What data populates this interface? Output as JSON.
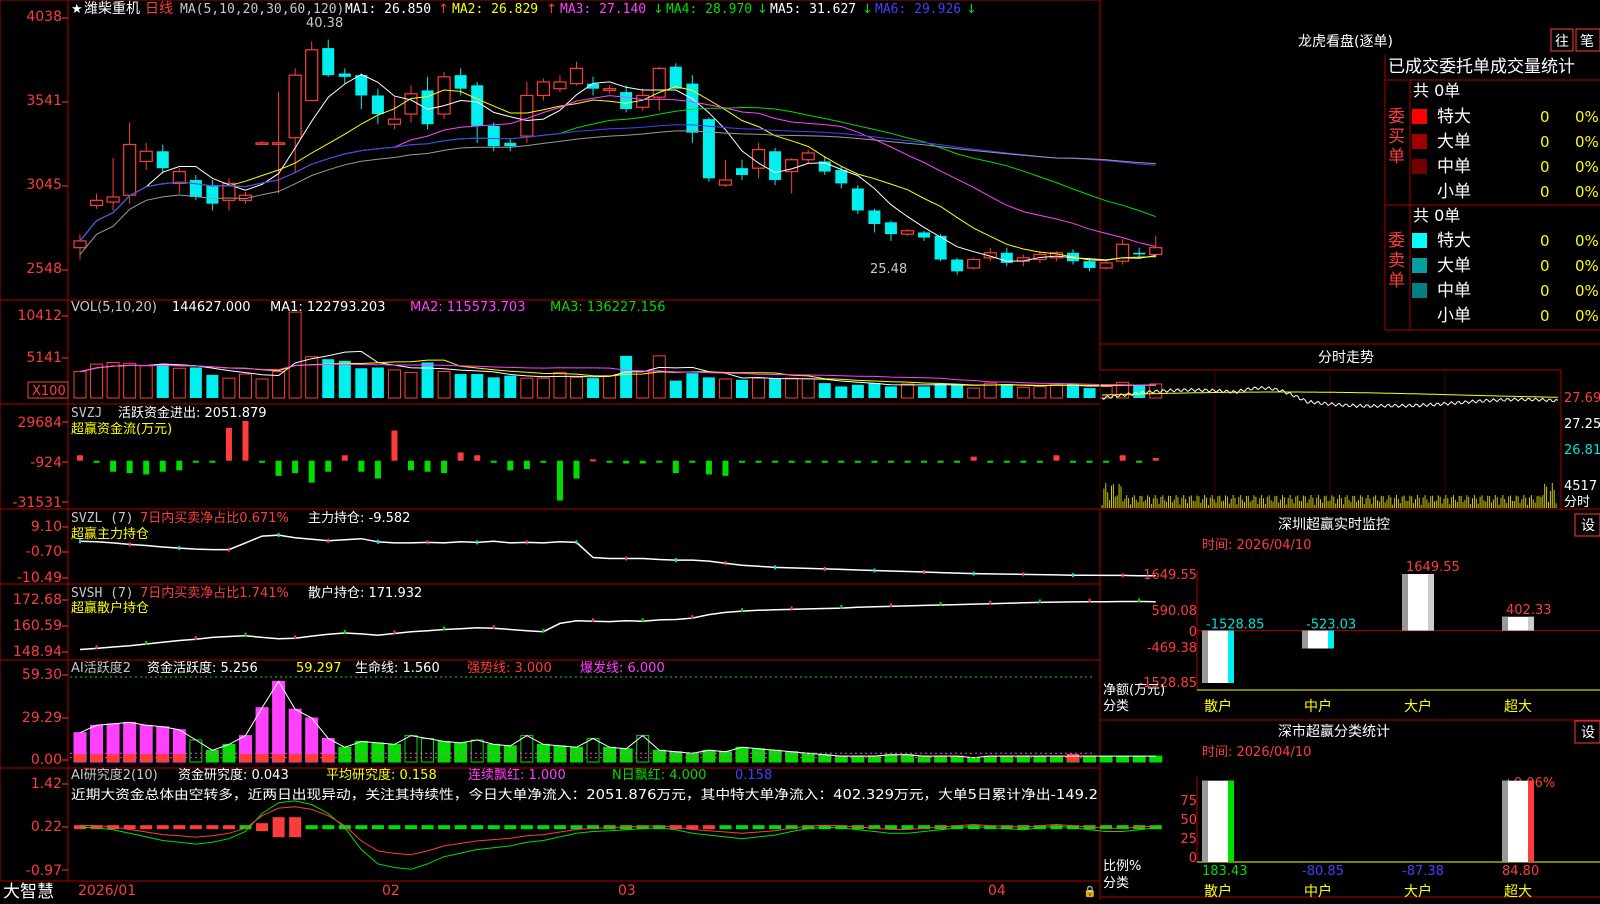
{
  "colors": {
    "grid_red": "#b00000",
    "axis_red": "#ff3c3c",
    "up": "#ff3c3c",
    "down": "#00f0f0",
    "white": "#ffffff",
    "yellow": "#ffff00",
    "magenta": "#ff40ff",
    "green": "#00dd00",
    "blue": "#4040ff",
    "gray": "#9a9a9a",
    "cyan_text": "#00e0e0"
  },
  "header": {
    "star": "★",
    "stock_name": "潍柴重机",
    "period": "日线",
    "ma_prefix": "MA(5,10,20,30,60,120)",
    "ma1": "MA1: 26.850",
    "ma1_arrow": "↑",
    "ma2": "MA2: 26.829",
    "ma2_arrow": "↑",
    "ma3": "MA3: 27.140",
    "ma3_arrow": "↓",
    "ma4": "MA4: 28.970",
    "ma4_arrow": "↓",
    "ma5": "MA5: 31.627",
    "ma5_arrow": "↓",
    "ma6": "MA6: 29.926",
    "ma6_arrow": "↓"
  },
  "kline": {
    "y_ticks": [
      "4038",
      "3541",
      "3045",
      "2548"
    ],
    "annot_high": "40.38",
    "annot_low": "25.48"
  },
  "vol": {
    "title": "VOL(5,10,20)",
    "value": "144627.000",
    "ma1": "MA1: 122793.203",
    "ma2": "MA2: 115573.703",
    "ma3": "MA3: 136227.156",
    "y_ticks": [
      "10412",
      "5141"
    ],
    "unit": "X100"
  },
  "svzj": {
    "title": "SVZJ",
    "label": "活跃资金进出: 2051.879",
    "sub": "超赢资金流(万元)",
    "y_ticks": [
      "29684",
      "-924",
      "-31531"
    ]
  },
  "svzl": {
    "title": "SVZL (7)",
    "label1": "7日内买卖净占比0.671%",
    "label2": "主力持仓: -9.582",
    "sub": "超赢主力持仓",
    "y_ticks": [
      "9.10",
      "-0.70",
      "-10.49"
    ]
  },
  "svsh": {
    "title": "SVSH (7)",
    "label1": "7日内买卖净占比1.741%",
    "label2": "散户持仓: 171.932",
    "sub": "超赢散户持仓",
    "y_ticks": [
      "172.68",
      "160.59",
      "148.94"
    ]
  },
  "ai1": {
    "title": "AI活跃度2",
    "label1": "资金活跃度: 5.256",
    "label2": "59.297",
    "label3": "生命线: 1.560",
    "label4": "强势线: 3.000",
    "label5": "爆发线: 6.000",
    "y_ticks": [
      "59.30",
      "29.29",
      "0.00"
    ]
  },
  "ai2": {
    "title": "AI研究度2(10)",
    "label1": "资金研究度: 0.043",
    "label2": "平均研究度: 0.158",
    "label3": "连续飘红: 1.000",
    "label4": "N日飘红: 4.000",
    "label5": "0.158",
    "commentary": "近期大资金总体由空转多，近两日出现异动，关注其持续性，今日大单净流入：2051.876万元，其中特大单净流入：402.329万元，大单5日累计净出-149.2",
    "y_ticks": [
      "1.42",
      "0.22",
      "-0.97"
    ]
  },
  "xaxis": {
    "brand": "大智慧",
    "labels": [
      "2026/01",
      "02",
      "03",
      "04"
    ]
  },
  "dragon_tiger": {
    "title": "龙虎看盘(逐单)",
    "btn1": "往",
    "btn2": "笔",
    "headline": "已成交委托单成交量统计",
    "buy_group": "委买单",
    "sell_group": "委卖单",
    "buy_total": "共 0单",
    "sell_total": "共 0单",
    "buy_rows": [
      {
        "label": "特大",
        "count": "0",
        "pct": "0%",
        "color": "#ff0000"
      },
      {
        "label": "大单",
        "count": "0",
        "pct": "0%",
        "color": "#a00000"
      },
      {
        "label": "中单",
        "count": "0",
        "pct": "0%",
        "color": "#700000"
      },
      {
        "label": "小单",
        "count": "0",
        "pct": "0%",
        "color": ""
      }
    ],
    "sell_rows": [
      {
        "label": "特大",
        "count": "0",
        "pct": "0%",
        "color": "#00ffff"
      },
      {
        "label": "大单",
        "count": "0",
        "pct": "0%",
        "color": "#00a0a0"
      },
      {
        "label": "中单",
        "count": "0",
        "pct": "0%",
        "color": "#008080"
      },
      {
        "label": "小单",
        "count": "0",
        "pct": "0%",
        "color": ""
      }
    ]
  },
  "intraday": {
    "title": "分时走势",
    "y_ticks": [
      "27.69",
      "27.25",
      "26.81"
    ],
    "vol_tick": "4517",
    "vol_unit": "分时"
  },
  "monitor": {
    "title": "深圳超赢实时监控",
    "btn": "设",
    "date": "时间: 2026/04/10",
    "y_ticks": [
      "1649.55",
      "590.08",
      "0",
      "-469.38",
      "-1528.85"
    ],
    "axis_title": "净额(万元)",
    "axis_sub": "分类",
    "categories": [
      "散户",
      "中户",
      "大户",
      "超大"
    ],
    "values": [
      -1528.85,
      -523.03,
      1649.55,
      402.33
    ],
    "value_labels": [
      "-1528.85",
      "-523.03",
      "1649.55",
      "402.33"
    ]
  },
  "classify": {
    "title": "深市超赢分类统计",
    "btn": "设",
    "date": "时间: 2026/04/10",
    "y_ticks": [
      "75",
      "50",
      "25",
      "0"
    ],
    "axis_title": "比例%",
    "axis_sub": "分类",
    "categories": [
      "散户",
      "中户",
      "大户",
      "超大"
    ],
    "values": [
      183.43,
      -80.85,
      -87.38,
      84.8
    ],
    "value_labels": [
      "183.43",
      "-80.85",
      "-87.38",
      "84.80"
    ],
    "annot": "+0.06%"
  },
  "chart_data": [
    {
      "type": "candlestick",
      "title": "潍柴重机 日线",
      "x_labels": [
        "2026/01",
        "02",
        "03",
        "04"
      ],
      "ylim": [
        2548,
        4038
      ],
      "candles": [
        [
          2680,
          2720,
          2610,
          2760
        ],
        [
          2930,
          2960,
          2910,
          3000
        ],
        [
          2950,
          2980,
          2900,
          3210
        ],
        [
          2990,
          3290,
          2940,
          3420
        ],
        [
          3190,
          3250,
          3140,
          3300
        ],
        [
          3250,
          3150,
          3120,
          3290
        ],
        [
          3060,
          3130,
          3000,
          3150
        ],
        [
          3080,
          2980,
          2960,
          3110
        ],
        [
          3050,
          2940,
          2900,
          3080
        ],
        [
          2960,
          3060,
          2900,
          3090
        ],
        [
          2960,
          2990,
          2940,
          3010
        ],
        [
          3300,
          3300,
          3300,
          3310
        ],
        [
          3300,
          3300,
          3000,
          3600
        ],
        [
          3330,
          3700,
          3120,
          3740
        ],
        [
          3550,
          3850,
          3600,
          3900
        ],
        [
          3860,
          3700,
          3690,
          3910
        ],
        [
          3710,
          3690,
          3650,
          3740
        ],
        [
          3700,
          3580,
          3500,
          3710
        ],
        [
          3580,
          3470,
          3410,
          3620
        ],
        [
          3410,
          3440,
          3380,
          3570
        ],
        [
          3470,
          3590,
          3420,
          3640
        ],
        [
          3610,
          3410,
          3380,
          3690
        ],
        [
          3470,
          3690,
          3440,
          3720
        ],
        [
          3700,
          3620,
          3580,
          3740
        ],
        [
          3640,
          3400,
          3300,
          3660
        ],
        [
          3400,
          3280,
          3250,
          3420
        ],
        [
          3300,
          3280,
          3250,
          3320
        ],
        [
          3340,
          3580,
          3300,
          3660
        ],
        [
          3580,
          3660,
          3550,
          3680
        ],
        [
          3620,
          3660,
          3600,
          3700
        ],
        [
          3650,
          3740,
          3640,
          3780
        ],
        [
          3650,
          3620,
          3580,
          3690
        ],
        [
          3610,
          3620,
          3590,
          3640
        ],
        [
          3600,
          3500,
          3480,
          3640
        ],
        [
          3510,
          3580,
          3490,
          3620
        ],
        [
          3570,
          3740,
          3490,
          3750
        ],
        [
          3750,
          3620,
          3640,
          3770
        ],
        [
          3650,
          3360,
          3300,
          3700
        ],
        [
          3440,
          3090,
          3070,
          3450
        ],
        [
          3050,
          3080,
          3040,
          3200
        ],
        [
          3150,
          3110,
          3080,
          3200
        ],
        [
          3150,
          3260,
          3090,
          3300
        ],
        [
          3250,
          3080,
          3050,
          3270
        ],
        [
          3130,
          3200,
          3000,
          3210
        ],
        [
          3200,
          3240,
          3180,
          3260
        ],
        [
          3190,
          3130,
          3110,
          3220
        ],
        [
          3140,
          3060,
          3030,
          3160
        ],
        [
          3030,
          2900,
          2880,
          3050
        ],
        [
          2900,
          2820,
          2770,
          2910
        ],
        [
          2830,
          2760,
          2720,
          2840
        ],
        [
          2760,
          2780,
          2750,
          2790
        ],
        [
          2770,
          2740,
          2720,
          2780
        ],
        [
          2750,
          2610,
          2600,
          2760
        ],
        [
          2610,
          2540,
          2520,
          2620
        ],
        [
          2560,
          2610,
          2550,
          2620
        ],
        [
          2620,
          2650,
          2600,
          2680
        ],
        [
          2650,
          2590,
          2570,
          2680
        ],
        [
          2600,
          2620,
          2570,
          2640
        ],
        [
          2610,
          2640,
          2590,
          2660
        ],
        [
          2620,
          2650,
          2600,
          2660
        ],
        [
          2650,
          2600,
          2580,
          2670
        ],
        [
          2600,
          2560,
          2540,
          2620
        ],
        [
          2560,
          2590,
          2550,
          2600
        ],
        [
          2600,
          2700,
          2580,
          2730
        ],
        [
          2650,
          2640,
          2620,
          2680
        ],
        [
          2640,
          2680,
          2620,
          2750
        ]
      ],
      "legend": [
        "MA1",
        "MA2",
        "MA3",
        "MA4",
        "MA5",
        "MA6"
      ]
    },
    {
      "type": "bar",
      "title": "VOL(5,10,20)",
      "ylim": [
        0,
        10412
      ],
      "values": [
        3200,
        4100,
        4300,
        4200,
        3900,
        4100,
        3600,
        3700,
        2800,
        2400,
        2900,
        2300,
        3200,
        10400,
        5000,
        4700,
        4500,
        3600,
        3700,
        3400,
        3100,
        4300,
        3200,
        2900,
        2900,
        2500,
        2700,
        2400,
        2400,
        3100,
        2500,
        2400,
        2700,
        5100,
        3200,
        5100,
        2100,
        3000,
        2500,
        2300,
        2200,
        2400,
        2400,
        2400,
        2300,
        1800,
        1400,
        1600,
        1800,
        1400,
        1700,
        1400,
        1700,
        1700,
        1200,
        1800,
        1700,
        1300,
        1400,
        1600,
        1700,
        1200,
        1400,
        1900,
        1600,
        1700
      ]
    },
    {
      "type": "bar",
      "title": "SVZJ 超赢资金流(万元)",
      "ylim": [
        -31531,
        29684
      ],
      "values": [
        4000,
        -100,
        -8000,
        -9000,
        -10000,
        -8000,
        -7000,
        -500,
        -400,
        24000,
        29000,
        -100,
        -11000,
        -9000,
        -16000,
        -8000,
        4000,
        -8000,
        -13000,
        22000,
        -7000,
        -8000,
        -9000,
        6000,
        4000,
        -1000,
        -7000,
        -6000,
        -500,
        -29000,
        -13000,
        1000,
        -1000,
        -2000,
        -2000,
        -1000,
        -9000,
        -1000,
        -10000,
        -11000,
        -1000,
        -1000,
        -1000,
        -1000,
        -1000,
        -1000,
        -1000,
        -1000,
        -1000,
        -1000,
        -1000,
        -1000,
        -1000,
        -1000,
        3000,
        -1000,
        -1000,
        -1000,
        -1000,
        4000,
        -1000,
        -1000,
        -1000,
        4000,
        -1000,
        2000
      ]
    },
    {
      "type": "line",
      "title": "SVZL 超赢主力持仓",
      "ylim": [
        -10.49,
        9.1
      ],
      "values": [
        3.6,
        3.4,
        3.0,
        2.4,
        2.0,
        1.4,
        1.0,
        0.6,
        0.4,
        0.4,
        3.0,
        5.6,
        6.0,
        5.0,
        4.4,
        3.8,
        4.2,
        4.6,
        3.4,
        3.0,
        3.0,
        3.2,
        3.0,
        3.4,
        3.2,
        3.6,
        3.0,
        3.2,
        3.0,
        3.4,
        3.2,
        -2.6,
        -3.0,
        -3.0,
        -3.0,
        -3.4,
        -3.6,
        -3.6,
        -4.0,
        -4.8,
        -5.6,
        -6.0,
        -6.4,
        -6.6,
        -6.8,
        -7.0,
        -7.2,
        -7.4,
        -7.6,
        -7.8,
        -8.0,
        -8.2,
        -8.4,
        -8.6,
        -8.8,
        -8.9,
        -9.0,
        -9.1,
        -9.2,
        -9.3,
        -9.4,
        -9.4,
        -9.5,
        -9.5,
        -9.6,
        -9.6
      ]
    },
    {
      "type": "line",
      "title": "SVSH 超赢散户持仓",
      "ylim": [
        148.94,
        172.68
      ],
      "values": [
        150.1,
        150.6,
        151.2,
        151.8,
        152.6,
        153.4,
        154.2,
        154.8,
        155.6,
        156.0,
        156.4,
        155.6,
        155.0,
        155.2,
        156.2,
        157.0,
        157.6,
        157.2,
        156.6,
        157.4,
        158.2,
        158.6,
        159.2,
        159.6,
        160.0,
        159.8,
        159.2,
        158.6,
        158.2,
        162.0,
        163.2,
        163.0,
        162.8,
        163.2,
        163.0,
        163.6,
        163.8,
        164.4,
        166.0,
        167.0,
        167.6,
        168.0,
        168.2,
        168.4,
        168.6,
        168.8,
        169.0,
        169.4,
        169.6,
        169.8,
        170.0,
        170.2,
        170.4,
        170.6,
        170.8,
        171.0,
        171.2,
        171.4,
        171.6,
        171.7,
        171.8,
        171.9,
        171.9,
        172.0,
        172.0,
        171.9
      ]
    },
    {
      "type": "bar",
      "title": "AI活跃度2",
      "ylim": [
        0,
        59.3
      ],
      "values": [
        20,
        25,
        26,
        27,
        25,
        24,
        22,
        15,
        8,
        12,
        18,
        37,
        55,
        36,
        30,
        16,
        10,
        14,
        13,
        12,
        18,
        16,
        14,
        13,
        15,
        12,
        11,
        18,
        12,
        11,
        10,
        16,
        10,
        9,
        18,
        8,
        7,
        6,
        8,
        7,
        10,
        9,
        8,
        7,
        6,
        5,
        4,
        4,
        4,
        5,
        5,
        4,
        4,
        4,
        3,
        4,
        4,
        4,
        4,
        4,
        4,
        4,
        4,
        4,
        4,
        4
      ],
      "red_days": [
        0,
        1,
        2,
        3,
        4,
        5,
        6,
        10,
        11,
        12,
        13,
        14,
        15,
        60
      ]
    },
    {
      "type": "line",
      "title": "AI研究度2(10)",
      "ylim": [
        -0.97,
        1.42
      ],
      "values": [
        0.22,
        0.2,
        0.15,
        0.05,
        -0.05,
        -0.15,
        -0.2,
        -0.25,
        -0.2,
        -0.1,
        0.1,
        0.6,
        0.9,
        0.95,
        0.85,
        0.6,
        0.2,
        -0.4,
        -0.8,
        -0.9,
        -0.95,
        -0.8,
        -0.6,
        -0.5,
        -0.4,
        -0.35,
        -0.3,
        -0.2,
        -0.15,
        -0.05,
        0.05,
        0.1,
        0.12,
        0.15,
        0.18,
        0.2,
        0.15,
        0.05,
        0.0,
        -0.05,
        -0.1,
        -0.05,
        0.0,
        0.1,
        0.18,
        0.22,
        0.2,
        0.15,
        0.1,
        0.05,
        0.05,
        0.1,
        0.15,
        0.2,
        0.25,
        0.2,
        0.18,
        0.15,
        0.2,
        0.25,
        0.2,
        0.15,
        0.1,
        0.1,
        0.15,
        0.2
      ]
    },
    {
      "type": "bar",
      "title": "深圳超赢实时监控",
      "categories": [
        "散户",
        "中户",
        "大户",
        "超大"
      ],
      "values": [
        -1528.85,
        -523.03,
        1649.55,
        402.33
      ],
      "ylabel": "净额(万元)",
      "ylim": [
        -1528.85,
        1649.55
      ]
    },
    {
      "type": "bar",
      "title": "深市超赢分类统计",
      "categories": [
        "散户",
        "中户",
        "大户",
        "超大"
      ],
      "values": [
        183.43,
        -80.85,
        -87.38,
        84.8
      ],
      "ylabel": "比例%",
      "ylim": [
        0,
        75
      ]
    }
  ]
}
